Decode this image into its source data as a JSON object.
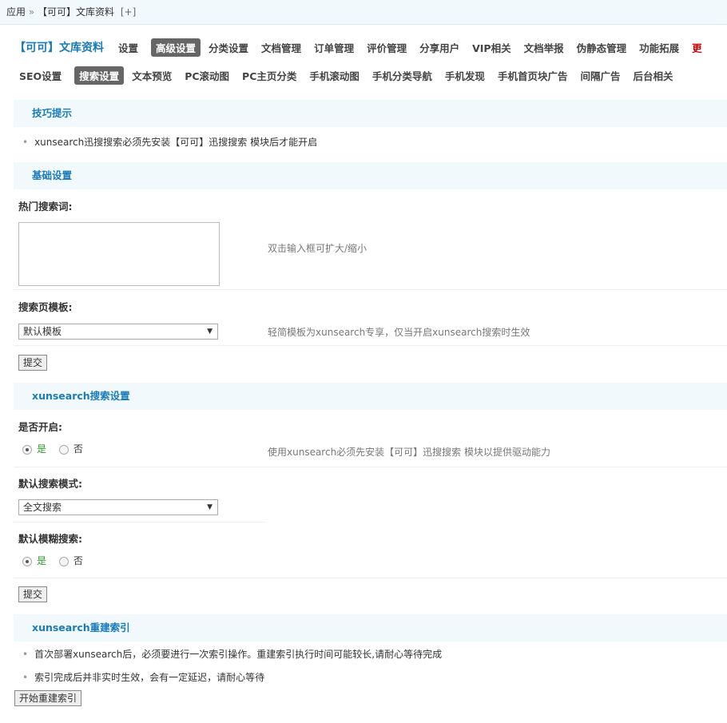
{
  "breadcrumb": {
    "root": "应用",
    "sep": "»",
    "current": "【可可】文库资料",
    "add": "[+]"
  },
  "nav1": {
    "brand": "【可可】文库资料",
    "items": [
      "设置",
      "高级设置",
      "分类设置",
      "文档管理",
      "订单管理",
      "评价管理",
      "分享用户",
      "VIP相关",
      "文档举报",
      "伪静态管理",
      "功能拓展",
      "更"
    ],
    "active": "高级设置"
  },
  "nav2": {
    "items": [
      "SEO设置",
      "搜索设置",
      "文本预览",
      "PC滚动图",
      "PC主页分类",
      "手机滚动图",
      "手机分类导航",
      "手机发现",
      "手机首页块广告",
      "间隔广告",
      "后台相关"
    ],
    "active": "搜索设置"
  },
  "tips": {
    "title": "技巧提示",
    "text": "xunsearch迅搜搜索必须先安装【可可】迅搜搜索 模块后才能开启"
  },
  "basic": {
    "title": "基础设置",
    "hot_label": "热门搜索词:",
    "hot_value": "",
    "hot_hint": "双击输入框可扩大/缩小",
    "tpl_label": "搜索页模板:",
    "tpl_value": "默认模板",
    "tpl_hint": "轻简模板为xunsearch专享，仅当开启xunsearch搜索时生效",
    "submit": "提交"
  },
  "xs": {
    "title": "xunsearch搜索设置",
    "enable_label": "是否开启:",
    "yes": "是",
    "no": "否",
    "enable_hint": "使用xunsearch必须先安装【可可】迅搜搜索 模块以提供驱动能力",
    "mode_label": "默认搜索模式:",
    "mode_value": "全文搜索",
    "fuzzy_label": "默认模糊搜索:",
    "submit": "提交"
  },
  "rebuild": {
    "title": "xunsearch重建索引",
    "note1": "首次部署xunsearch后，必须要进行一次索引操作。重建索引执行时间可能较长,请耐心等待完成",
    "note2": "索引完成后并非实时生效，会有一定延迟，请耐心等待",
    "button": "开始重建索引"
  }
}
